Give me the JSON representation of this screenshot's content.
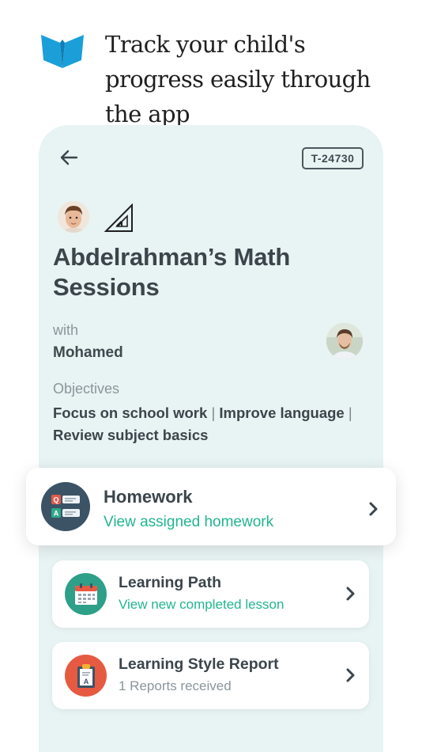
{
  "headline": "Track your child's progress easily through the app",
  "header": {
    "session_code": "T-24730"
  },
  "session": {
    "title": "Abdelrahman’s Math Sessions",
    "with_label": "with",
    "tutor_name": "Mohamed",
    "objectives_label": "Objectives",
    "objectives": [
      "Focus on school work",
      "Improve language",
      "Review subject basics"
    ],
    "separator": "|"
  },
  "cards": {
    "homework": {
      "title": "Homework",
      "subtitle": "View assigned homework",
      "icon": "qa-icon"
    },
    "learning_path": {
      "title": "Learning Path",
      "subtitle": "View new completed lesson",
      "icon": "calendar-icon"
    },
    "learning_style": {
      "title": "Learning Style Report",
      "subtitle": "1 Reports received",
      "icon": "report-clipboard-icon"
    }
  },
  "colors": {
    "brand_blue": "#1a9fd9",
    "phone_bg": "#e8f3f3",
    "accent_green": "#22b592",
    "homework_circle": "#3c5366",
    "path_circle": "#2e9f88",
    "style_circle": "#e65a42"
  }
}
